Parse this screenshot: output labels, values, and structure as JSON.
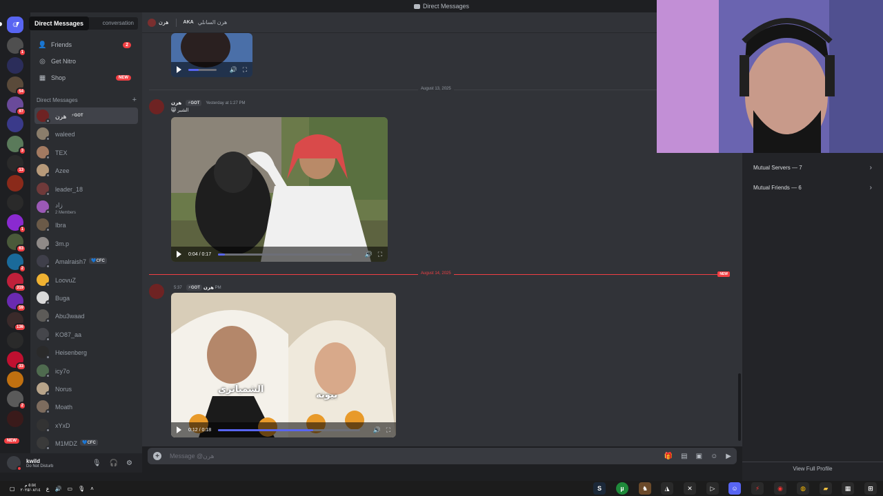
{
  "titlebar": {
    "title": "Direct Messages"
  },
  "tooltip": {
    "text": "Direct Messages"
  },
  "find": {
    "placeholder": "conversation"
  },
  "nav": [
    {
      "label": "Friends",
      "icon": "friends-icon",
      "count": "2"
    },
    {
      "label": "Get Nitro",
      "icon": "nitro-icon"
    },
    {
      "label": "Shop",
      "icon": "shop-icon",
      "badge": "NEW"
    }
  ],
  "dm_header": {
    "label": "Direct Messages",
    "add": "+"
  },
  "dms": [
    {
      "name": "هرن",
      "tag": "⚡GOT",
      "color": "#6e2323",
      "active": true
    },
    {
      "name": "waleed",
      "color": "#8a7d6b"
    },
    {
      "name": "TEX",
      "color": "#a37a61"
    },
    {
      "name": "Azee",
      "color": "#b79a7a"
    },
    {
      "name": "leader_18",
      "color": "#6f3a3a"
    },
    {
      "name": "زاد",
      "sub": "2 Members",
      "color": "#9b59b6"
    },
    {
      "name": "Ibra",
      "color": "#6b5a48"
    },
    {
      "name": "3m.p",
      "color": "#8f8a88"
    },
    {
      "name": "Amalraish7",
      "tag": "💙CFC",
      "color": "#3f3f4a"
    },
    {
      "name": "LoovuZ",
      "color": "#f0b232"
    },
    {
      "name": "Buga",
      "color": "#d9d9d9"
    },
    {
      "name": "Abu3waad",
      "color": "#5d5b58"
    },
    {
      "name": "KO87_aa",
      "color": "#45464b"
    },
    {
      "name": "Heisenberg",
      "color": "#2a2a2a"
    },
    {
      "name": "icy7o",
      "color": "#4f6b4f"
    },
    {
      "name": "Norus",
      "color": "#b8a48a"
    },
    {
      "name": "Moath",
      "color": "#7d6c5e"
    },
    {
      "name": "xYxD",
      "color": "#333"
    },
    {
      "name": "M1MDZ",
      "tag": "💙CFC",
      "color": "#3a3a3a"
    }
  ],
  "servers": [
    {
      "badge": "1",
      "color": "#4f4f4f"
    },
    {
      "badge": "",
      "color": "#2b2d5a"
    },
    {
      "badge": "54",
      "color": "#5a4a3a"
    },
    {
      "badge": "97",
      "color": "#6a4a9a"
    },
    {
      "badge": "",
      "color": "#3a3a8a"
    },
    {
      "badge": "3",
      "color": "#5a7a5a"
    },
    {
      "badge": "13",
      "color": "#2a2a2a"
    },
    {
      "badge": "",
      "color": "#8a2a1a"
    },
    {
      "badge": "",
      "color": "#2a2a2a"
    },
    {
      "badge": "1",
      "color": "#8a2ad0"
    },
    {
      "badge": "63",
      "color": "#4a5a3a"
    },
    {
      "badge": "2",
      "color": "#1a6a9a"
    },
    {
      "badge": "319",
      "color": "#c0203a"
    },
    {
      "badge": "59",
      "color": "#6a2ab0"
    },
    {
      "badge": "136",
      "color": "#3a2a2a"
    },
    {
      "badge": "",
      "color": "#2a2a2a"
    },
    {
      "badge": "33",
      "color": "#c01030"
    },
    {
      "badge": "",
      "color": "#c07010"
    },
    {
      "badge": "2",
      "color": "#5a5a5a"
    },
    {
      "badge": "",
      "color": "#3a1a1a"
    }
  ],
  "rail_new": "NEW",
  "user": {
    "name": "kwild",
    "status": "Do Not Disturb"
  },
  "chat_header": {
    "name": "هرن",
    "aka": "AKA",
    "alias": "هرن السانلي"
  },
  "messages": [
    {
      "date": "August 13, 2025",
      "author": "هرن",
      "tag": "⚡GOT",
      "time": "Yesterday at 1:27 PM",
      "text": "😸 الشبر",
      "video": {
        "time": "0:04 / 0:17",
        "progress": 0.05
      }
    },
    {
      "date": "August 14, 2025",
      "new": "NEW",
      "author": "هرن",
      "tag": "⚡GOT",
      "time": "5:37 PM",
      "video": {
        "time": "0:12 / 0:18",
        "progress": 0.67,
        "caption_left": "الشمياتزي",
        "caption_right": "بيونه"
      }
    }
  ],
  "first_video_progress": 0.35,
  "composer": {
    "placeholder": "Message @هرن"
  },
  "profile": {
    "rows": [
      {
        "label": "Mutual Servers — 7"
      },
      {
        "label": "Mutual Friends — 6"
      }
    ],
    "view_full": "View Full Profile"
  },
  "tray": {
    "time": "٥:٥٤ م",
    "date": "٢٠٢٥/٠٨/١٤",
    "lang": "ع"
  }
}
